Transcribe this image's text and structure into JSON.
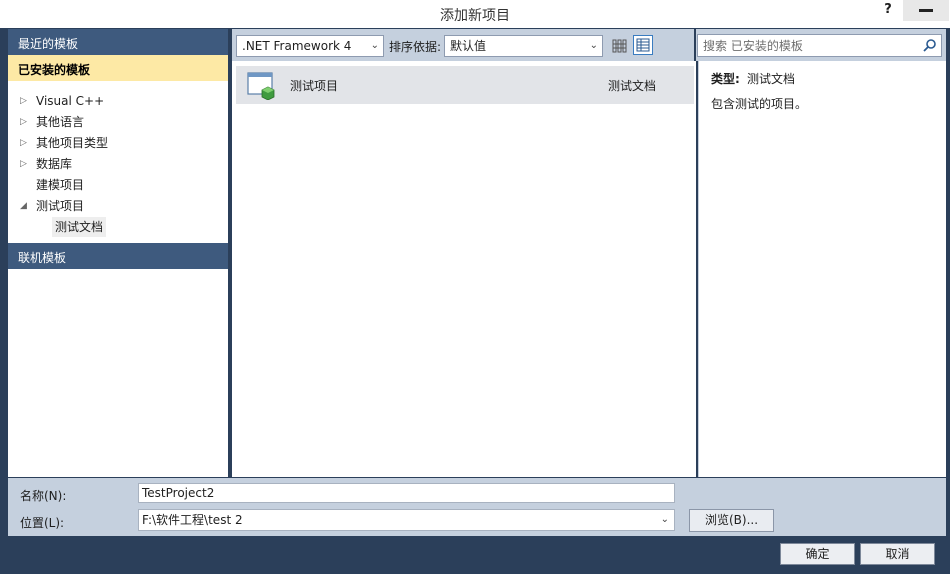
{
  "window": {
    "title": "添加新项目",
    "help_label": "?"
  },
  "sidebar": {
    "recent_label": "最近的模板",
    "installed_label": "已安装的模板",
    "online_label": "联机模板",
    "tree": [
      {
        "label": "Visual C++",
        "arrow": "▷"
      },
      {
        "label": "其他语言",
        "arrow": "▷"
      },
      {
        "label": "其他项目类型",
        "arrow": "▷"
      },
      {
        "label": "数据库",
        "arrow": "▷"
      },
      {
        "label": "建模项目",
        "arrow": ""
      },
      {
        "label": "测试项目",
        "arrow": "◢"
      }
    ],
    "selected_child": "测试文档"
  },
  "toolbar": {
    "framework_value": ".NET Framework 4",
    "sort_label": "排序依据:",
    "sort_value": "默认值"
  },
  "search": {
    "placeholder": "搜索 已安装的模板"
  },
  "templates": [
    {
      "name": "测试项目",
      "category": "测试文档"
    }
  ],
  "details": {
    "type_label": "类型:",
    "type_value": "测试文档",
    "description": "包含测试的项目。"
  },
  "form": {
    "name_label": "名称(N):",
    "name_value": "TestProject2",
    "location_label": "位置(L):",
    "location_value": "F:\\软件工程\\test 2",
    "browse_label": "浏览(B)..."
  },
  "buttons": {
    "ok_label": "确定",
    "cancel_label": "取消"
  },
  "colors": {
    "frame": "#2b3f5a",
    "header": "#3e5a7e",
    "selected_group": "#fde9a5",
    "panel": "#c5d0de"
  }
}
